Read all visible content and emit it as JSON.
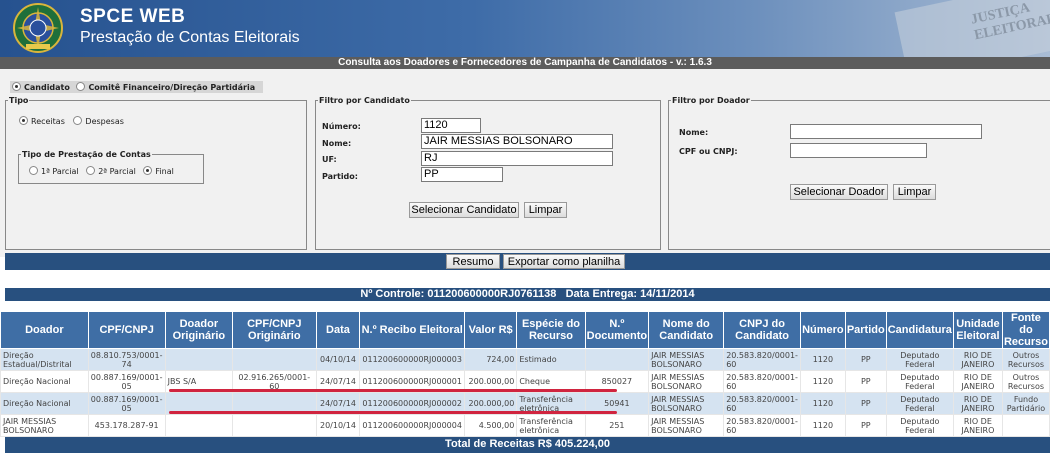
{
  "app": {
    "title": "SPCE WEB",
    "subtitle": "Prestação de Contas Eleitorais",
    "deco_text": "JUSTIÇA ELEITORAL"
  },
  "system_bar": "Consulta aos Doadores e Fornecedores de Campanha de Candidatos - v.: 1.6.3",
  "mode": {
    "options": [
      {
        "label": "Candidato",
        "selected": true
      },
      {
        "label": "Comitê Financeiro/Direção Partidária",
        "selected": false
      }
    ]
  },
  "tipo": {
    "legend": "Tipo",
    "options": [
      {
        "label": "Receitas",
        "selected": true
      },
      {
        "label": "Despesas",
        "selected": false
      }
    ],
    "prestacao": {
      "legend": "Tipo de Prestação de Contas",
      "options": [
        {
          "label": "1ª Parcial",
          "selected": false
        },
        {
          "label": "2ª Parcial",
          "selected": false
        },
        {
          "label": "Final",
          "selected": true
        }
      ]
    }
  },
  "filtro_candidato": {
    "legend": "Filtro por Candidato",
    "numero_label": "Número:",
    "numero_value": "1120",
    "nome_label": "Nome:",
    "nome_value": "JAIR MESSIAS BOLSONARO",
    "uf_label": "UF:",
    "uf_value": "RJ",
    "partido_label": "Partido:",
    "partido_value": "PP",
    "select_button": "Selecionar Candidato",
    "clear_button": "Limpar"
  },
  "filtro_doador": {
    "legend": "Filtro por Doador",
    "nome_label": "Nome:",
    "nome_value": "",
    "cpf_label": "CPF ou CNPJ:",
    "cpf_value": "",
    "select_button": "Selecionar Doador",
    "clear_button": "Limpar"
  },
  "actions": {
    "resumo": "Resumo",
    "exportar": "Exportar como planilha"
  },
  "control_bar": "Nº Controle: 011200600000RJ0761138   Data Entrega: 14/11/2014",
  "table": {
    "headers": [
      "Doador",
      "CPF/CNPJ",
      "Doador Originário",
      "CPF/CNPJ Originário",
      "Data",
      "N.º Recibo Eleitoral",
      "Valor R$",
      "Espécie do Recurso",
      "N.º Documento",
      "Nome do Candidato",
      "CNPJ do Candidato",
      "Número",
      "Partido",
      "Candidatura",
      "Unidade Eleitoral",
      "Fonte do Recurso"
    ],
    "rows": [
      [
        "Direção Estadual/Distrital",
        "08.810.753/0001-74",
        "",
        "",
        "04/10/14",
        "011200600000RJ000003",
        "724,00",
        "Estimado",
        "",
        "JAIR MESSIAS BOLSONARO",
        "20.583.820/0001-60",
        "1120",
        "PP",
        "Deputado Federal",
        "RIO DE JANEIRO",
        "Outros Recursos"
      ],
      [
        "Direção Nacional",
        "00.887.169/0001-05",
        "JBS S/A",
        "02.916.265/0001-60",
        "24/07/14",
        "011200600000RJ000001",
        "200.000,00",
        "Cheque",
        "850027",
        "JAIR MESSIAS BOLSONARO",
        "20.583.820/0001-60",
        "1120",
        "PP",
        "Deputado Federal",
        "RIO DE JANEIRO",
        "Outros Recursos"
      ],
      [
        "Direção Nacional",
        "00.887.169/0001-05",
        "",
        "",
        "24/07/14",
        "011200600000RJ000002",
        "200.000,00",
        "Transferência eletrônica",
        "50941",
        "JAIR MESSIAS BOLSONARO",
        "20.583.820/0001-60",
        "1120",
        "PP",
        "Deputado Federal",
        "RIO DE JANEIRO",
        "Fundo Partidário"
      ],
      [
        "JAIR MESSIAS BOLSONARO",
        "453.178.287-91",
        "",
        "",
        "20/10/14",
        "011200600000RJ000004",
        "4.500,00",
        "Transferência eletrônica",
        "251",
        "JAIR MESSIAS BOLSONARO",
        "20.583.820/0001-60",
        "1120",
        "PP",
        "Deputado Federal",
        "RIO DE JANEIRO",
        ""
      ]
    ]
  },
  "total": "Total de Receitas R$ 405.224,00",
  "colors": {
    "header_blue": "#3f6ea5",
    "bar_blue": "#28507f",
    "row_alt": "#d5e3f1",
    "highlight_red": "#d0243f"
  }
}
